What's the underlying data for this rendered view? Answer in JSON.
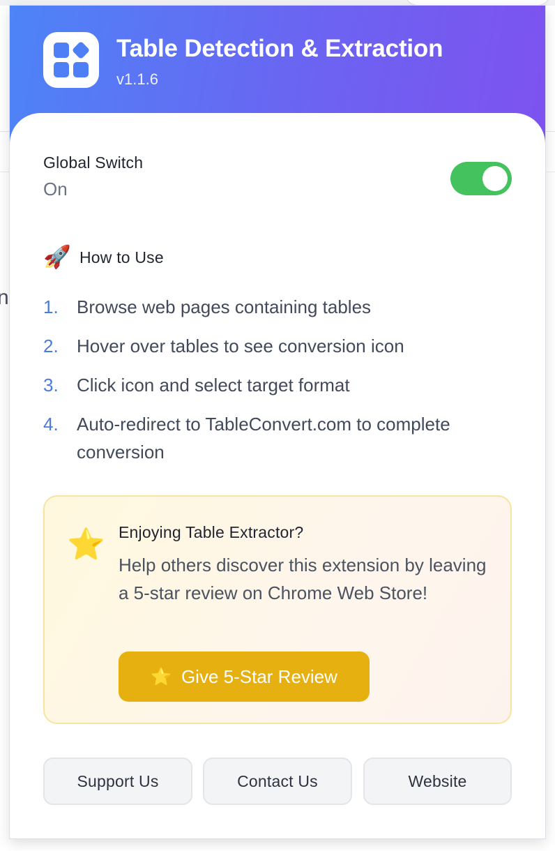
{
  "header": {
    "title": "Table Detection & Extraction",
    "version": "v1.1.6"
  },
  "global_switch": {
    "label": "Global Switch",
    "state": "On",
    "enabled": true,
    "toggle_color": "#43c25e"
  },
  "how_to_use": {
    "icon": "rocket-icon",
    "title": "How to Use",
    "steps": [
      {
        "num": "1.",
        "text": "Browse web pages containing tables"
      },
      {
        "num": "2.",
        "text": "Hover over tables to see conversion icon"
      },
      {
        "num": "3.",
        "text": "Click icon and select target format"
      },
      {
        "num": "4.",
        "text": "Auto-redirect to TableConvert.com to complete conversion"
      }
    ]
  },
  "review": {
    "icon": "star-icon",
    "title": "Enjoying Table Extractor?",
    "description": "Help others discover this extension by leaving a 5-star review on Chrome Web Store!",
    "button_label": "Give 5-Star Review",
    "button_color": "#e6b010"
  },
  "footer": {
    "buttons": [
      "Support Us",
      "Contact Us",
      "Website"
    ]
  },
  "colors": {
    "header_gradient_start": "#4d84f7",
    "header_gradient_end": "#7e52ef",
    "accent_number": "#4a7bdc"
  }
}
